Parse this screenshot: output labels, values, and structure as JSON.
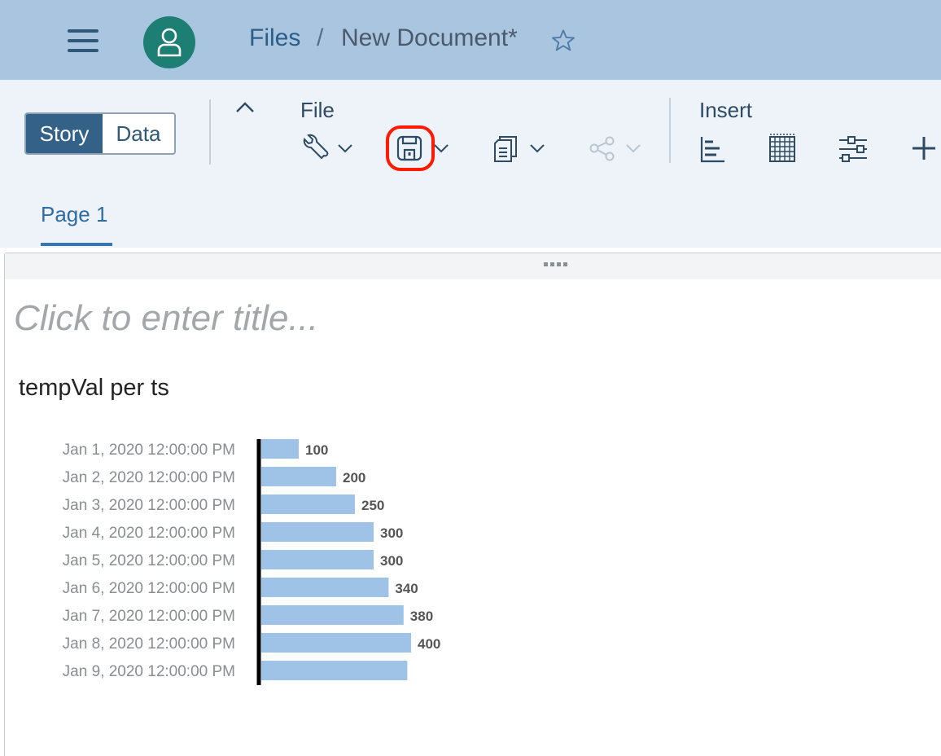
{
  "shell": {
    "breadcrumb": {
      "files": "Files",
      "separator": "/",
      "document": "New Document*"
    }
  },
  "toolbar": {
    "segmented": {
      "story": "Story",
      "data": "Data"
    },
    "file_group_label": "File",
    "insert_group_label": "Insert",
    "file_icons": [
      "wrench-icon",
      "save-icon",
      "copy-icon",
      "share-icon"
    ],
    "insert_icons": [
      "bar-chart-icon",
      "table-icon",
      "input-control-icon",
      "plus-icon"
    ]
  },
  "page_tabs": {
    "page1": "Page 1"
  },
  "canvas": {
    "title_placeholder": "Click to enter title..."
  },
  "colors": {
    "shellbar": "#a9c5df",
    "toolbar": "#edf3f9",
    "accent": "#346187",
    "bar": "#9fc3e7",
    "highlight": "#ff1a00"
  },
  "chart_data": {
    "type": "bar",
    "orientation": "horizontal",
    "title": "tempVal per ts",
    "categories": [
      "Jan 1, 2020 12:00:00 PM",
      "Jan 2, 2020 12:00:00 PM",
      "Jan 3, 2020 12:00:00 PM",
      "Jan 4, 2020 12:00:00 PM",
      "Jan 5, 2020 12:00:00 PM",
      "Jan 6, 2020 12:00:00 PM",
      "Jan 7, 2020 12:00:00 PM",
      "Jan 8, 2020 12:00:00 PM",
      "Jan 9, 2020 12:00:00 PM"
    ],
    "values": [
      100,
      200,
      250,
      300,
      300,
      340,
      380,
      400,
      390
    ],
    "data_labels": [
      "100",
      "200",
      "250",
      "300",
      "300",
      "340",
      "380",
      "400",
      ""
    ],
    "grid": false
  }
}
